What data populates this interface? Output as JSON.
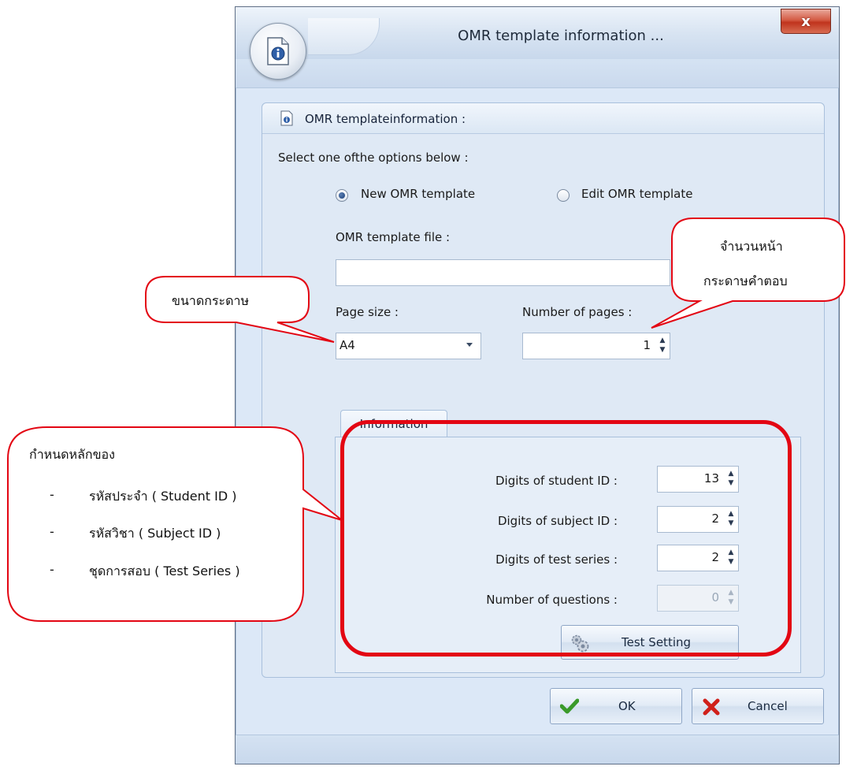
{
  "window": {
    "title": "OMR template information ...",
    "close_label": "x",
    "app_icon": "info-document-icon"
  },
  "group": {
    "title": "OMR templateinformation :",
    "icon": "info-document-icon"
  },
  "form": {
    "select_prompt": "Select one ofthe options below :",
    "radio_new_label": "New OMR template",
    "radio_edit_label": "Edit OMR template",
    "radio_selected": "new",
    "template_file_label": "OMR template file :",
    "template_file_value": "",
    "page_size_label": "Page size :",
    "page_size_value": "A4",
    "num_pages_label": "Number of pages :",
    "num_pages_value": "1"
  },
  "tab": {
    "label": "Information",
    "fields": [
      {
        "label": "Digits of student ID :",
        "value": "13",
        "enabled": true
      },
      {
        "label": "Digits of subject ID :",
        "value": "2",
        "enabled": true
      },
      {
        "label": "Digits of test series :",
        "value": "2",
        "enabled": true
      },
      {
        "label": "Number of questions :",
        "value": "0",
        "enabled": false
      }
    ],
    "test_setting_label": "Test Setting"
  },
  "buttons": {
    "ok_label": "OK",
    "cancel_label": "Cancel"
  },
  "annotations": {
    "page_size_note": "ขนาดกระดาษ",
    "pages_note_line1": "จำนวนหน้า",
    "pages_note_line2": "กระดาษคำตอบ",
    "digits_note_title": "กำหนดหลักของ",
    "digits_note_items": [
      {
        "dash": "-",
        "text": "รหัสประจำ ( Student ID )"
      },
      {
        "dash": "-",
        "text": "รหัสวิชา ( Subject ID )"
      },
      {
        "dash": "-",
        "text": "ชุดการสอบ ( Test Series )"
      }
    ]
  },
  "colors": {
    "annotation_red": "#e30613",
    "ok_check": "#3a9a2a",
    "cancel_x": "#d0201a"
  }
}
